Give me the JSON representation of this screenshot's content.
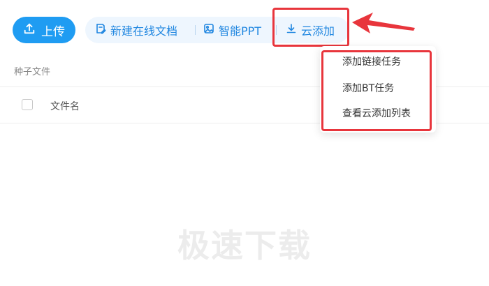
{
  "toolbar": {
    "upload_label": "上传",
    "new_doc_label": "新建在线文档",
    "smart_ppt_label": "智能PPT",
    "cloud_add_label": "云添加"
  },
  "table": {
    "section_label": "种子文件",
    "column_filename": "文件名"
  },
  "empty_state": "极速下载",
  "dropdown": {
    "items": [
      "添加链接任务",
      "添加BT任务",
      "查看云添加列表"
    ]
  },
  "colors": {
    "primary": "#1f9cf2",
    "link": "#1f86e0",
    "annotation": "#e8353c",
    "pill_bg": "#eef6fe"
  },
  "icons": {
    "upload": "upload-icon",
    "new_doc": "edit-doc-icon",
    "smart_ppt": "image-icon",
    "cloud_add": "download-icon"
  }
}
